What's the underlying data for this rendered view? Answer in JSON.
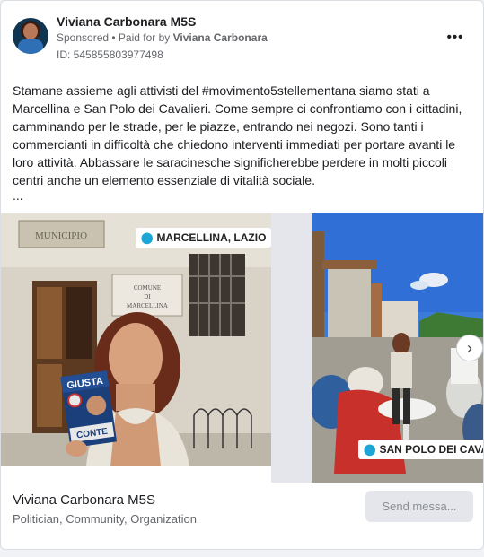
{
  "header": {
    "page_name": "Viviana Carbonara M5S",
    "sponsored": "Sponsored",
    "paid_for_prefix": " • Paid for by ",
    "payer": "Viviana Carbonara",
    "ad_id": "ID: 545855803977498",
    "more_label": "•••"
  },
  "post": {
    "text": "Stamane assieme agli attivisti del #movimento5stellementana siamo stati a Marcellina e San Polo dei Cavalieri. Come sempre ci confrontiamo con i cittadini, camminando per le strade, per le piazze, entrando nei negozi. Sono tanti i commercianti in difficoltà che chiedono interventi immediati per portare avanti le loro attività. Abbassare le saracinesche significherebbe perdere in molti piccoli centri anche un elemento essenziale di vitalità sociale.",
    "ellipsis": "..."
  },
  "carousel": {
    "slides": [
      {
        "location": "MARCELLINA, LAZIO",
        "sign_top": "MUNICIPIO",
        "sign_plaque_1": "COMUNE",
        "sign_plaque_2": "DI",
        "sign_plaque_3": "MARCELLINA",
        "leaflet_top": "GIUSTA",
        "leaflet_bottom": "CONTE"
      },
      {
        "location": "SAN POLO DEI CAVALIERI, LAZ"
      }
    ],
    "next_label": "›"
  },
  "footer": {
    "name": "Viviana Carbonara M5S",
    "category": "Politician, Community, Organization",
    "send_label": "Send messa..."
  },
  "colors": {
    "accent_pin": "#1da5d6",
    "muted_text": "#65676b",
    "button_bg": "#e4e6eb"
  }
}
